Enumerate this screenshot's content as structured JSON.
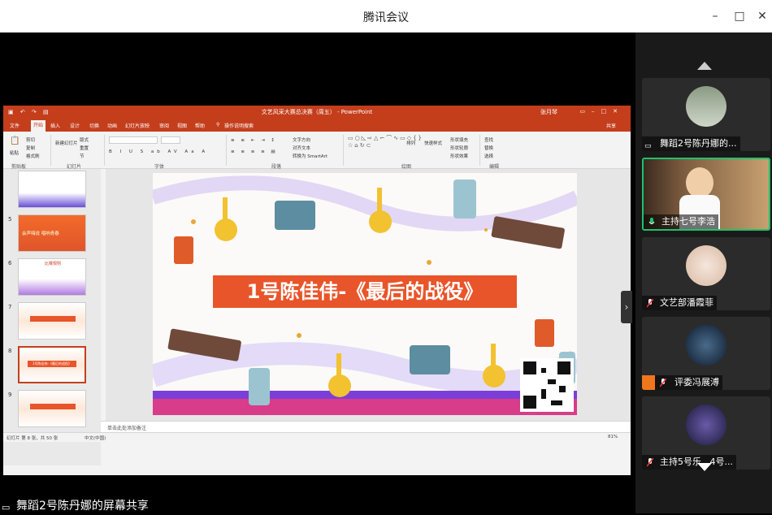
{
  "window": {
    "title": "腾讯会议",
    "controls": [
      "minimize",
      "maximize",
      "close"
    ]
  },
  "ppt": {
    "doc_title": "文艺风采大赛总决赛（周五） - PowerPoint",
    "user": "张月琴",
    "tabs": [
      "文件",
      "开始",
      "插入",
      "设计",
      "切换",
      "动画",
      "幻灯片放映",
      "审阅",
      "视图",
      "帮助",
      "操作说明搜索",
      "共享"
    ],
    "active_tab": "开始",
    "ribbon": {
      "groups": [
        "剪贴板",
        "幻灯片",
        "字体",
        "段落",
        "绘图",
        "编辑"
      ],
      "items": [
        "剪切",
        "复制",
        "格式刷",
        "粘贴",
        "新建幻灯片",
        "版式",
        "重置",
        "节",
        "文字方向",
        "对齐文本",
        "转换为 SmartArt",
        "排列",
        "快速样式",
        "形状填充",
        "形状轮廓",
        "形状效果",
        "查找",
        "替换",
        "选择"
      ]
    },
    "thumbnails": [
      {
        "num": "5",
        "text": "会声嗨说 唱响青春"
      },
      {
        "num": "6",
        "text": "比赛规则"
      },
      {
        "num": "7",
        "text": ""
      },
      {
        "num": "8",
        "text": "1号陈佳伟-《最后的战役》"
      },
      {
        "num": "9",
        "text": ""
      }
    ],
    "slide": {
      "banner": "1号陈佳伟-《最后的战役》"
    },
    "notes_placeholder": "单击此处添加备注",
    "status": {
      "slide_info": "幻灯片 第 8 张，共 50 张",
      "language": "中文(中国)",
      "zoom": "81%"
    }
  },
  "participants": [
    {
      "name": "舞蹈2号陈丹娜的...",
      "muted": false,
      "sharing": true
    },
    {
      "name": "主持七号李浩",
      "muted": false,
      "active": true
    },
    {
      "name": "文艺部潘霞菲",
      "muted": true
    },
    {
      "name": "评委冯展溥",
      "muted": true
    },
    {
      "name": "主持5号乐...4号...",
      "muted": true
    }
  ],
  "share_label": "舞蹈2号陈丹娜的屏幕共享",
  "colors": {
    "ppt_accent": "#c43e1c",
    "active_border": "#1ec26b",
    "banner": "#e8552a"
  }
}
